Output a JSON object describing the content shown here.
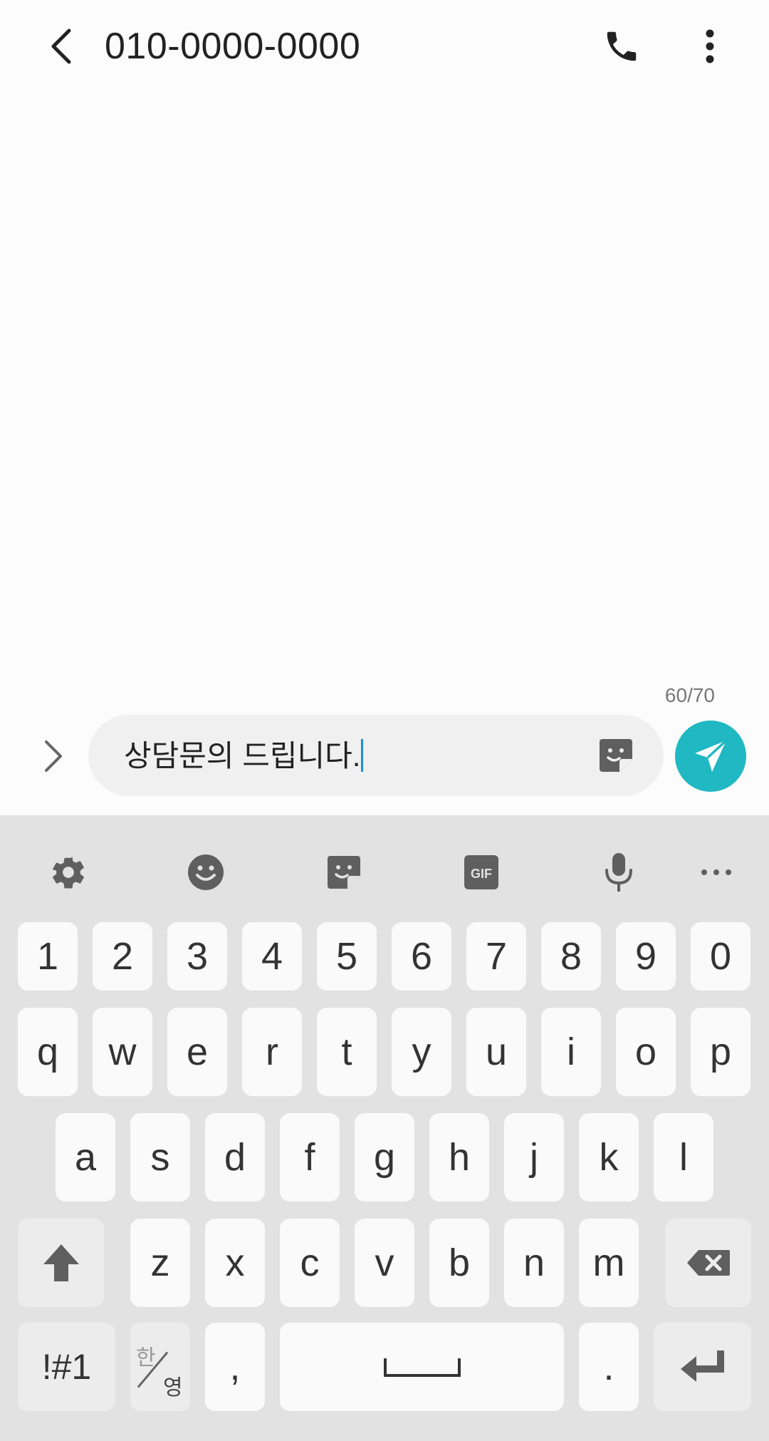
{
  "header": {
    "title": "010-0000-0000"
  },
  "composer": {
    "char_counter": "60/70",
    "message_text": "상담문의 드립니다."
  },
  "keyboard": {
    "toolbar": [
      "settings-icon",
      "emoji-icon",
      "sticker-icon",
      "gif-icon",
      "microphone-icon",
      "more-icon"
    ],
    "gif_label": "GIF",
    "row_numbers": [
      "1",
      "2",
      "3",
      "4",
      "5",
      "6",
      "7",
      "8",
      "9",
      "0"
    ],
    "row_top": [
      "q",
      "w",
      "e",
      "r",
      "t",
      "y",
      "u",
      "i",
      "o",
      "p"
    ],
    "row_middle": [
      "a",
      "s",
      "d",
      "f",
      "g",
      "h",
      "j",
      "k",
      "l"
    ],
    "row_bottom": [
      "z",
      "x",
      "c",
      "v",
      "b",
      "n",
      "m"
    ],
    "symbols_label": "!#1",
    "lang_han": "한",
    "lang_yeong": "영",
    "comma_label": ",",
    "period_label": "."
  },
  "colors": {
    "accent": "#20b8c2",
    "caret": "#1b8fd6",
    "keyboard_bg": "#e2e2e2"
  }
}
